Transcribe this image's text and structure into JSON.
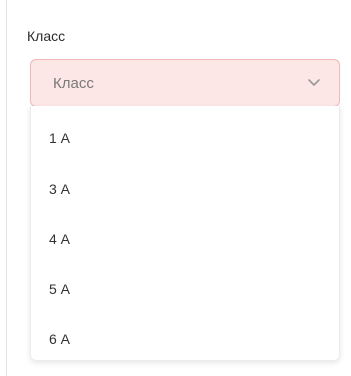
{
  "field": {
    "label": "Класс",
    "placeholder": "Класс",
    "chevron_icon": "chevron-down-icon"
  },
  "dropdown": {
    "options": [
      {
        "label": "1 А"
      },
      {
        "label": "3 А"
      },
      {
        "label": "4 А"
      },
      {
        "label": "5 А"
      },
      {
        "label": "6 А"
      }
    ]
  },
  "colors": {
    "select_background": "#fce6e6",
    "select_border": "#f0b8b8"
  }
}
